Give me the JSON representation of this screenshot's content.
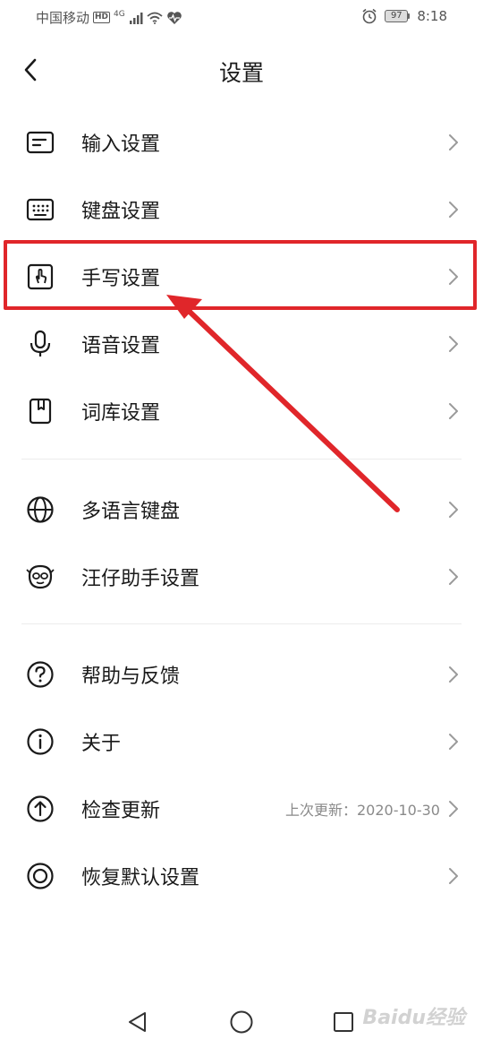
{
  "status_bar": {
    "carrier": "中国移动",
    "hd": "HD",
    "net": "4G",
    "battery": "97",
    "time": "8:18"
  },
  "header": {
    "title": "设置"
  },
  "groups": [
    [
      {
        "label": "输入设置",
        "icon": "input-settings-icon"
      },
      {
        "label": "键盘设置",
        "icon": "keyboard-icon"
      },
      {
        "label": "手写设置",
        "icon": "handwriting-icon"
      },
      {
        "label": "语音设置",
        "icon": "microphone-icon"
      },
      {
        "label": "词库设置",
        "icon": "dictionary-icon"
      }
    ],
    [
      {
        "label": "多语言键盘",
        "icon": "globe-icon"
      },
      {
        "label": "汪仔助手设置",
        "icon": "assistant-icon"
      }
    ],
    [
      {
        "label": "帮助与反馈",
        "icon": "help-icon"
      },
      {
        "label": "关于",
        "icon": "info-icon"
      },
      {
        "label": "检查更新",
        "icon": "update-icon",
        "extra": "上次更新：2020-10-30"
      },
      {
        "label": "恢复默认设置",
        "icon": "restore-icon"
      }
    ]
  ],
  "annotation": {
    "highlight_color": "#e0262a",
    "highlighted_item": "手写设置"
  },
  "watermark": "Baidu经验"
}
